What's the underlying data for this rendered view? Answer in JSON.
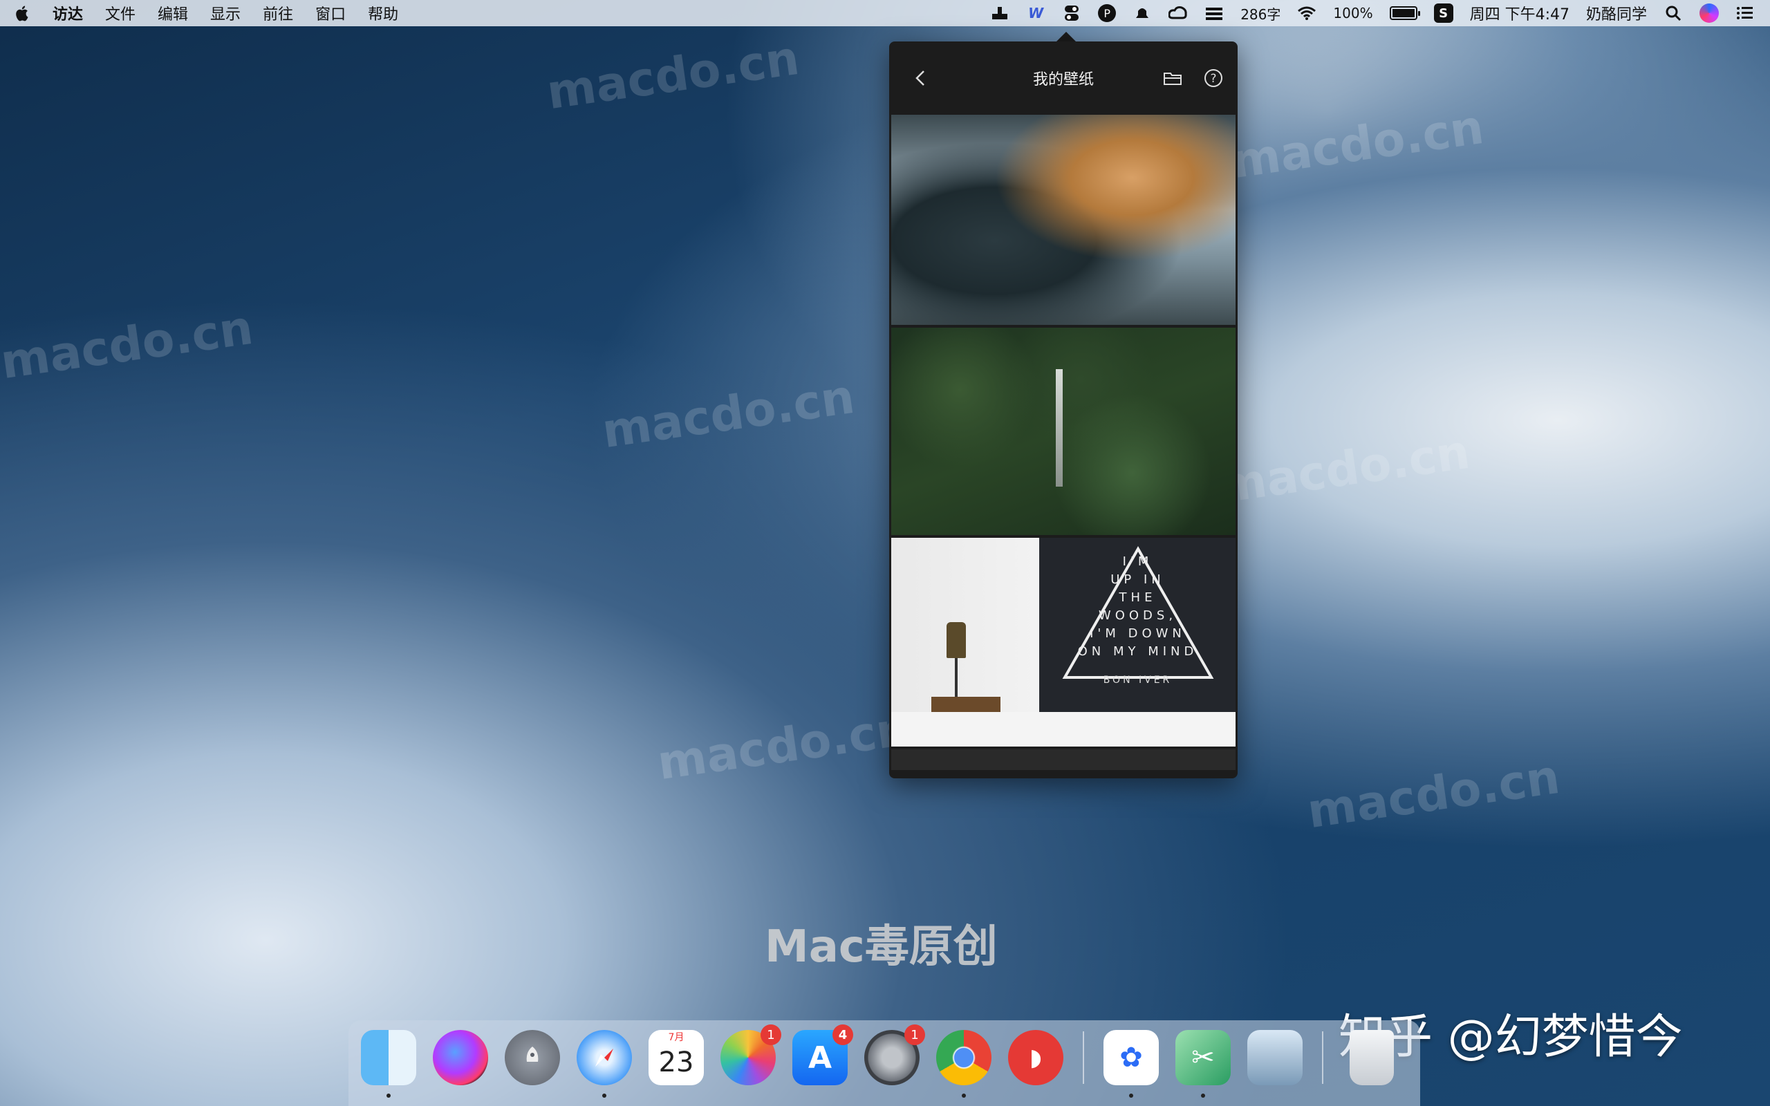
{
  "menubar": {
    "left_items": [
      "访达",
      "文件",
      "编辑",
      "显示",
      "前往",
      "窗口",
      "帮助"
    ],
    "word_count": "286字",
    "battery": "100%",
    "clock": "周四 下午4:47",
    "user": "奶酪同学"
  },
  "panel": {
    "title": "我的壁纸",
    "poster_text": "I'M\nUP IN\nTHE\nWOODS,\nI'M DOWN\nON MY MIND",
    "poster_sign": "BON IVER"
  },
  "watermarks": [
    "macdo.cn",
    "macdo.cn",
    "macdo.cn",
    "macdo.cn",
    "macdo.cn",
    "macdo.cn",
    "macdo.cn"
  ],
  "signature": "Mac毒原创",
  "zhihu": "知乎 @幻梦惜今",
  "dock": {
    "calendar_month": "7月",
    "calendar_day": "23",
    "badges": {
      "photos": "1",
      "appstore": "4",
      "prefs": "1"
    }
  },
  "icons": [
    "apple-icon",
    "folder-icon",
    "help-icon",
    "back-icon",
    "wifi-icon",
    "search-icon",
    "siri-icon",
    "control-center-icon"
  ]
}
